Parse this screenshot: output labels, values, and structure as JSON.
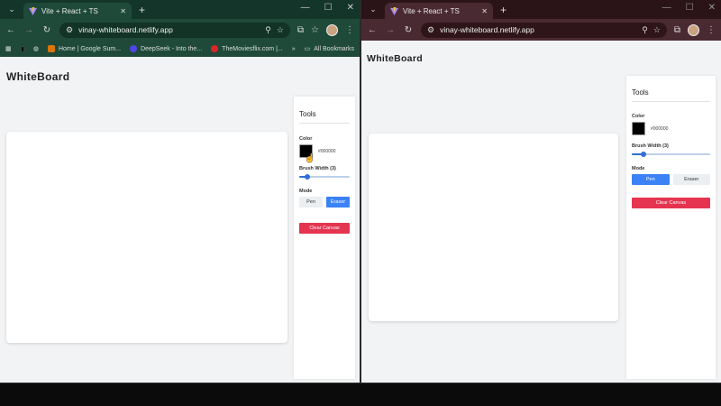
{
  "windows": {
    "left": {
      "tab_title": "Vite + React + TS",
      "url": "vinay-whiteboard.netlify.app",
      "bookmarks": [
        {
          "label": "Home | Google Sum..."
        },
        {
          "label": "DeepSeek - Into the..."
        },
        {
          "label": "TheMoviesflix.com |..."
        }
      ],
      "all_bookmarks": "All Bookmarks",
      "heading": "WhiteBoard",
      "tools": {
        "title": "Tools",
        "color_label": "Color",
        "color_value": "#000000",
        "brush_label": "Brush Width (3)",
        "brush_fraction": 0.12,
        "mode_label": "Mode",
        "pen_label": "Pen",
        "eraser_label": "Eraser",
        "active_mode": "eraser",
        "clear_label": "Clear Canvas"
      }
    },
    "right": {
      "tab_title": "Vite + React + TS",
      "url": "vinay-whiteboard.netlify.app",
      "heading": "WhiteBoard",
      "tools": {
        "title": "Tools",
        "color_label": "Color",
        "color_value": "#000000",
        "brush_label": "Brush Width (3)",
        "brush_fraction": 0.12,
        "mode_label": "Mode",
        "pen_label": "Pen",
        "eraser_label": "Eraser",
        "active_mode": "pen",
        "clear_label": "Clear Canvas"
      }
    }
  },
  "icons": {
    "favicon": "vite-logo-icon",
    "nav_back": "arrow-left-icon",
    "nav_forward": "arrow-right-icon",
    "reload": "reload-icon",
    "site_info": "tune-icon",
    "zoom": "magnifier-icon",
    "star": "star-icon",
    "extensions": "puzzle-icon",
    "menu": "kebab-menu-icon"
  },
  "colors": {
    "accent_blue": "#3b82f6",
    "clear_red": "#e53450",
    "left_frame": "#1f4a3a",
    "right_frame": "#4a2a32"
  }
}
